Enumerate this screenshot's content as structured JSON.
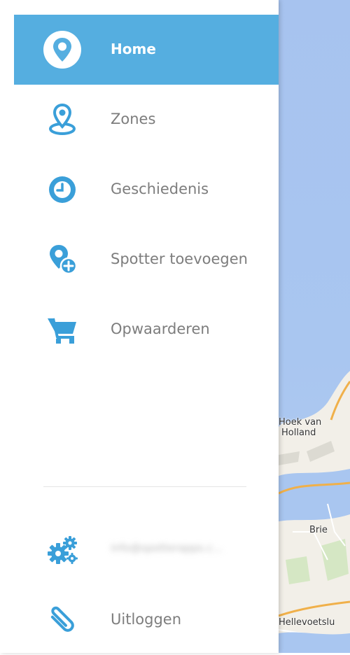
{
  "colors": {
    "accent": "#55aee0",
    "icon": "#3a9fd9",
    "label": "#7d7d7d",
    "active_label": "#ffffff",
    "map_water": "#a9c6f0",
    "map_land": "#f2efe8",
    "road": "#f0b04a"
  },
  "menu": {
    "items": [
      {
        "label": "Home",
        "icon": "map-pin-icon",
        "active": true
      },
      {
        "label": "Zones",
        "icon": "zone-pin-icon",
        "active": false
      },
      {
        "label": "Geschiedenis",
        "icon": "clock-icon",
        "active": false
      },
      {
        "label": "Spotter toevoegen",
        "icon": "add-pin-icon",
        "active": false
      },
      {
        "label": "Opwaarderen",
        "icon": "cart-icon",
        "active": false
      }
    ]
  },
  "account": {
    "settings_icon": "gears-icon",
    "email": "info@spotterapps.c...",
    "logout_label": "Uitloggen",
    "logout_icon": "paperclip-icon"
  },
  "map": {
    "labels": {
      "hoek_line1": "Hoek van",
      "hoek_line2": "Holland",
      "brielle": "Brie",
      "hellevoetsluis": "Hellevoetslu"
    }
  }
}
